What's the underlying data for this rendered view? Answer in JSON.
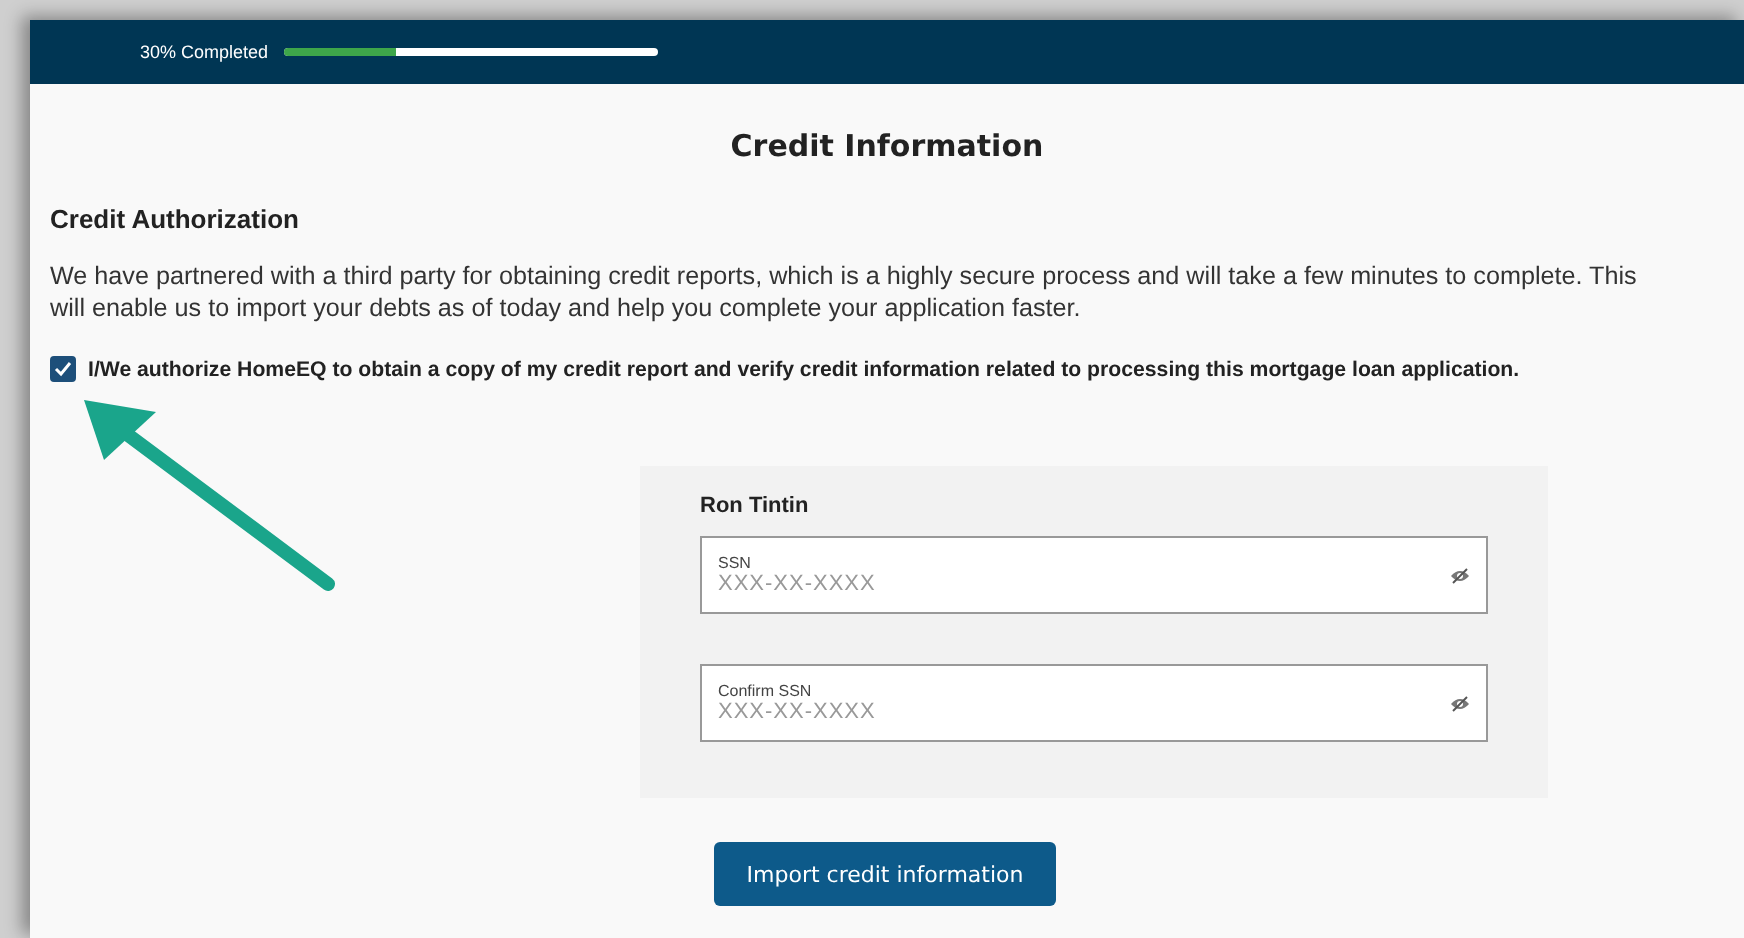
{
  "progress": {
    "label": "30% Completed",
    "level": 0.3
  },
  "page_title": "Credit Information",
  "section_title": "Credit Authorization",
  "intro_lines": [
    "We have partnered with a third party for obtaining credit reports, which is a highly secure process and will take a few minutes to complete. This",
    "will enable us to import your debts as of today and help you complete your application faster."
  ],
  "authorization": {
    "label": "I/We authorize HomeEQ to obtain a copy of my credit report and verify credit information related to processing this mortgage loan application.",
    "checked": true
  },
  "borrower": {
    "name": "Ron Tintin",
    "fields": [
      {
        "label": "SSN",
        "placeholder": "XXX-XX-XXXX"
      },
      {
        "label": "Confirm SSN",
        "placeholder": "XXX-XX-XXXX"
      }
    ]
  },
  "button": "Import credit information"
}
